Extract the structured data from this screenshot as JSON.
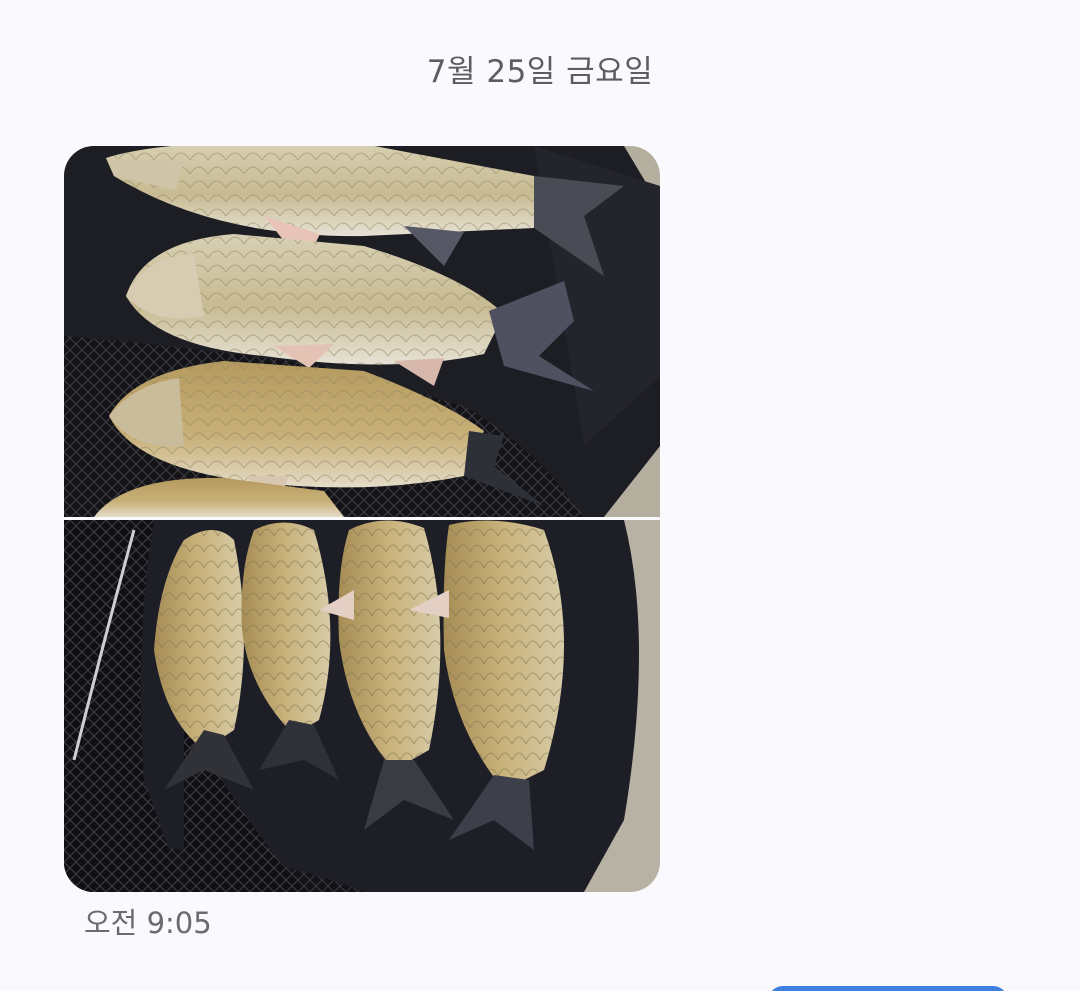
{
  "conversation": {
    "date_separator": "7월 25일 금요일",
    "messages": [
      {
        "direction": "incoming",
        "attachments": [
          {
            "type": "photo",
            "icon": "photo-fish-net-top"
          },
          {
            "type": "photo",
            "icon": "photo-fish-net-bottom"
          }
        ],
        "time": "오전 9:05"
      }
    ]
  },
  "colors": {
    "background": "#f9f9fe",
    "meta_text": "#5c5c63",
    "outgoing_bubble": "#3f7fe0"
  }
}
